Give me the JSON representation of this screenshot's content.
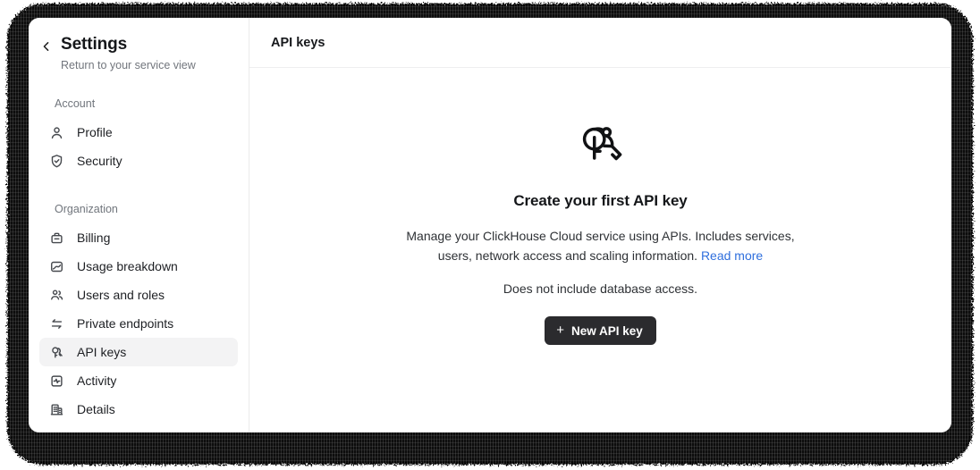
{
  "window": {
    "sidebar": {
      "back_icon": "chevron-left-icon",
      "title": "Settings",
      "subtitle": "Return to your service view",
      "groups": [
        {
          "label": "Account",
          "items": [
            {
              "label": "Profile",
              "icon": "user-icon",
              "active": false
            },
            {
              "label": "Security",
              "icon": "shield-check-icon",
              "active": false
            }
          ]
        },
        {
          "label": "Organization",
          "items": [
            {
              "label": "Billing",
              "icon": "briefcase-icon",
              "active": false
            },
            {
              "label": "Usage breakdown",
              "icon": "chart-image-icon",
              "active": false
            },
            {
              "label": "Users and roles",
              "icon": "users-icon",
              "active": false
            },
            {
              "label": "Private endpoints",
              "icon": "arrows-exchange-icon",
              "active": false
            },
            {
              "label": "API keys",
              "icon": "keys-icon",
              "active": true
            },
            {
              "label": "Activity",
              "icon": "activity-square-icon",
              "active": false
            },
            {
              "label": "Details",
              "icon": "building-icon",
              "active": false
            }
          ]
        }
      ]
    },
    "main": {
      "header_title": "API keys",
      "empty_state": {
        "illustration_icon": "two-keys-icon",
        "title": "Create your first API key",
        "description_part1": "Manage your ClickHouse Cloud service using APIs. Includes services, users, network access and scaling information. ",
        "link_label": "Read more",
        "note": "Does not include database access.",
        "button_label": "New API key",
        "button_plus": "+"
      }
    }
  },
  "colors": {
    "accent_link": "#2f6fdd",
    "button_bg": "#2b2b2e",
    "active_item_bg": "#f3f3f4",
    "frame": "#000000"
  }
}
